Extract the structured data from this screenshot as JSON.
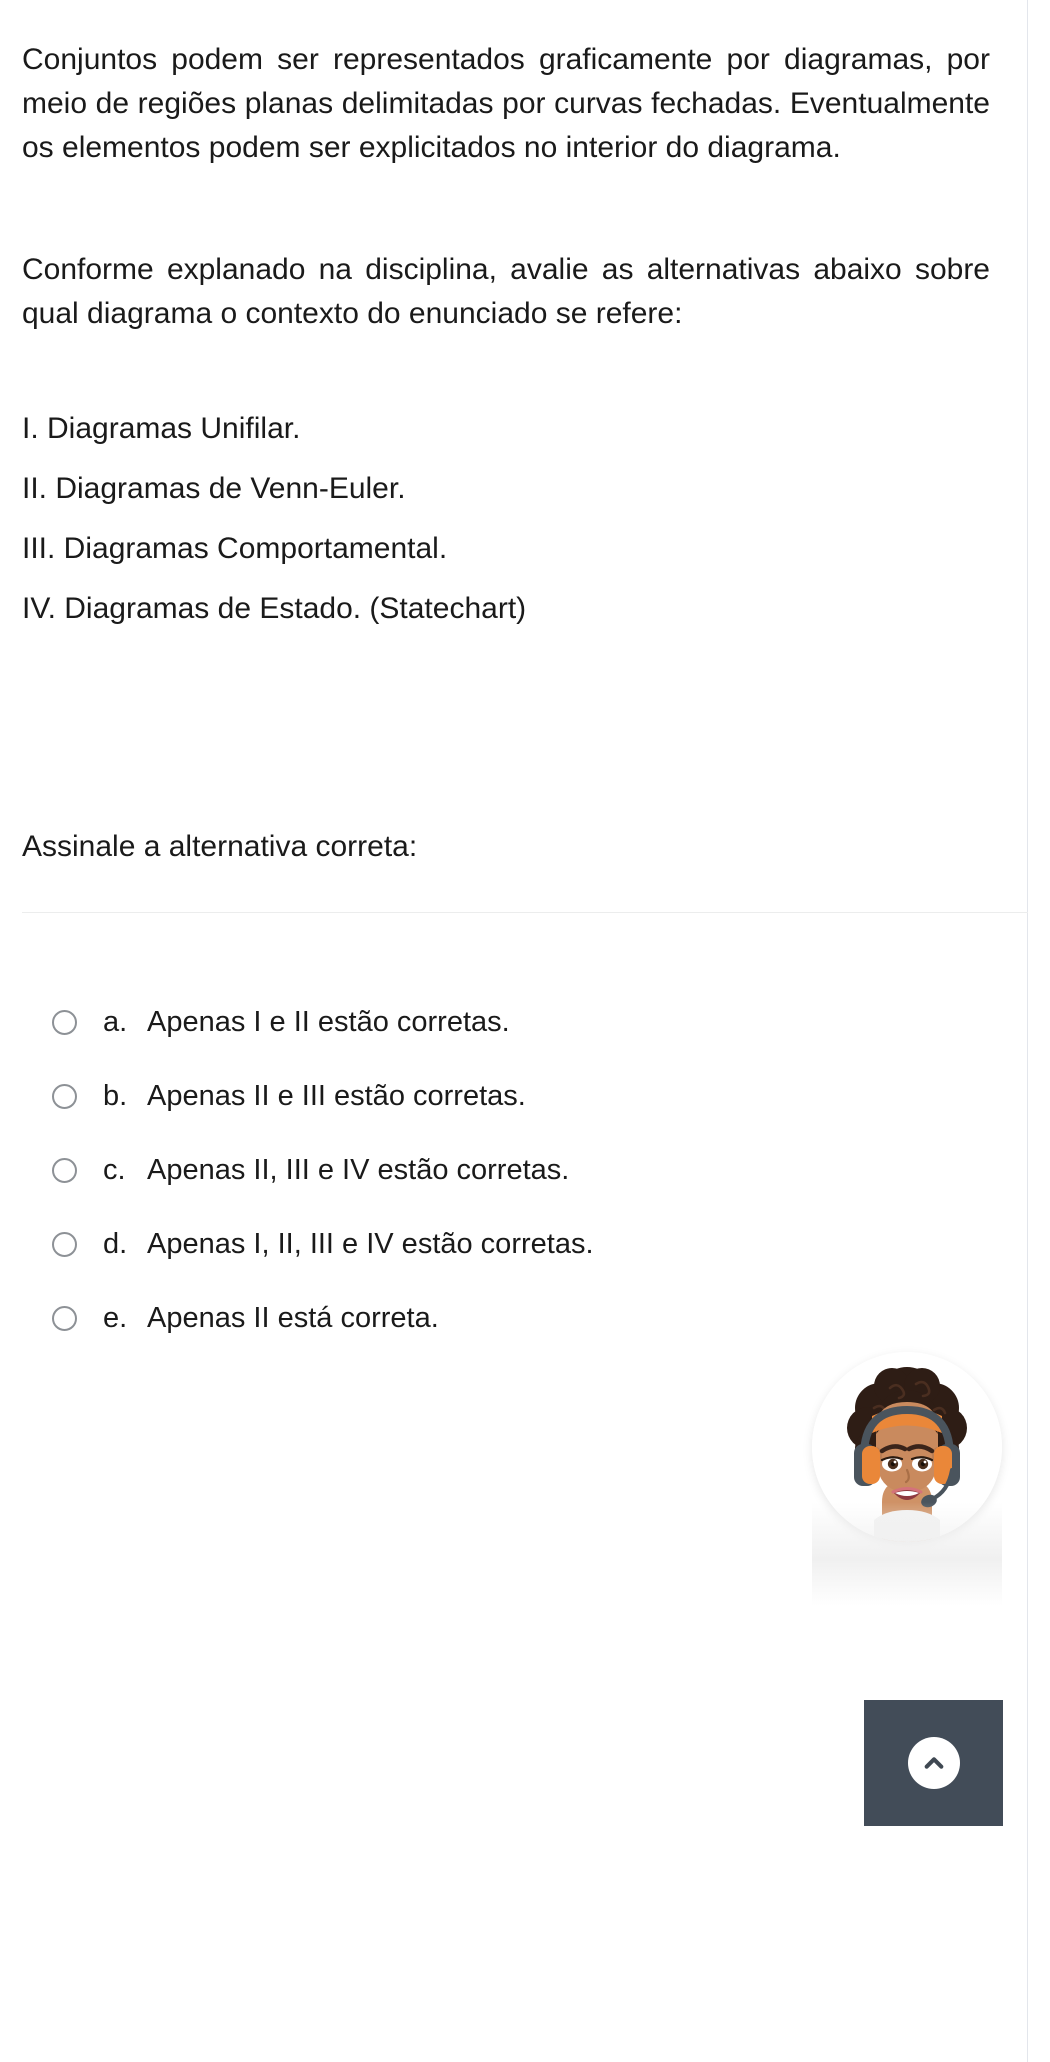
{
  "question": {
    "paragraph_1": "Conjuntos podem ser representados graficamente por diagramas, por meio de regiões planas delimitadas por curvas fechadas. Eventualmente os elementos podem ser explicitados no interior do diagrama.",
    "paragraph_2": "Conforme explanado na disciplina, avalie as alternativas abaixo sobre qual diagrama o contexto do enunciado se refere:",
    "statements": [
      "I. Diagramas Unifilar.",
      "II. Diagramas de Venn-Euler.",
      "III. Diagramas Comportamental.",
      "IV. Diagramas de Estado. (Statechart)"
    ],
    "prompt": "Assinale a alternativa correta:"
  },
  "answers": [
    {
      "letter": "a.",
      "text": "Apenas I e II estão corretas.",
      "selected": false
    },
    {
      "letter": "b.",
      "text": "Apenas II e III estão corretas.",
      "selected": false
    },
    {
      "letter": "c.",
      "text": "Apenas II, III e IV estão corretas.",
      "selected": false
    },
    {
      "letter": "d.",
      "text": "Apenas I, II, III e IV estão corretas.",
      "selected": false
    },
    {
      "letter": "e.",
      "text": "Apenas II está correta.",
      "selected": false
    }
  ],
  "widgets": {
    "support_avatar": {
      "icon": "support-agent-avatar-icon"
    },
    "scroll_to_top": {
      "icon": "chevron-up-icon",
      "background_color": "#424c58"
    }
  },
  "colors": {
    "text": "#1a1a1a",
    "divider": "#eceded",
    "radio_border": "#8d9196",
    "page_background": "#ffffff",
    "rule": "#e3e6ec"
  }
}
